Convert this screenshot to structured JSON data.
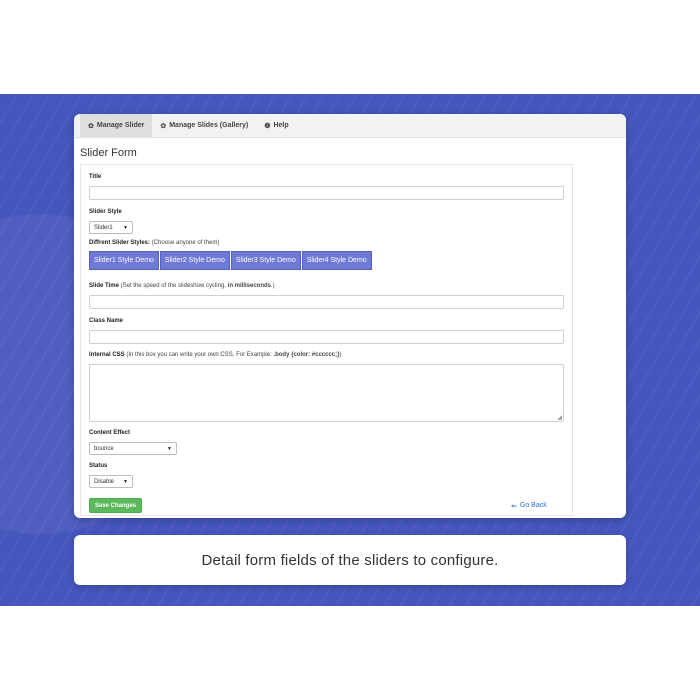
{
  "tabs": [
    {
      "icon": "gear-icon",
      "glyph": "✿",
      "label": "Manage Slider"
    },
    {
      "icon": "gear-icon",
      "glyph": "✿",
      "label": "Manage Slides (Gallery)"
    },
    {
      "icon": "info-icon",
      "glyph": "❶",
      "label": "Help"
    }
  ],
  "form": {
    "heading": "Slider Form",
    "title_label": "Title",
    "title_value": "",
    "style_label": "Slider Style",
    "style_selected": "Slider1",
    "styles_label": "Diffrent Slider Styles:",
    "styles_note": "(Choose anyone of them)",
    "demos": [
      "Slider1 Style Demo",
      "Slider2 Style Demo",
      "Slider3 Style Demo",
      "Slider4 Style Demo"
    ],
    "slide_time_label": "Slide Time",
    "slide_time_note": "(Set the speed of the slideshow cycling,",
    "slide_time_note_bold": "in milliseconds",
    "slide_time_note_end": ".)",
    "class_label": "Class Name",
    "css_label": "Internal CSS",
    "css_note": "(In this box you can write your own CSS, For Example:",
    "css_note_bold": ".body {color: #cccccc;}",
    "css_note_end": ")",
    "effect_label": "Content Effect",
    "effect_selected": "bounce",
    "status_label": "Status",
    "status_selected": "Disable",
    "save_label": "Save Changes",
    "back_label": "Go Back",
    "back_glyph": "⇐"
  },
  "caption": "Detail form fields of the sliders to configure."
}
